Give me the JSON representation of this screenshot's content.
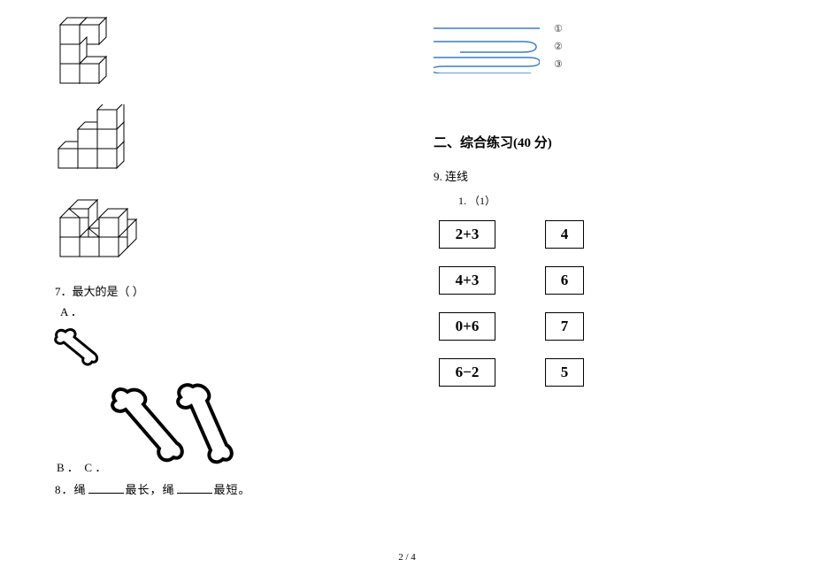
{
  "col_left": {
    "q7": {
      "label": "7．最大的是（  ）",
      "opt_a": "A ．",
      "opt_bc": "B ．  C ．"
    },
    "q8": {
      "prefix": "8．绳",
      "mid": "最长，绳",
      "suffix": "最短。"
    }
  },
  "col_right": {
    "ropes": {
      "n1": "①",
      "n2": "②",
      "n3": "③"
    },
    "section2_heading": "二、综合练习(40 分)",
    "q9_label": "9. 连线",
    "q9_sub": "1. （1）",
    "match_left": [
      "2+3",
      "4+3",
      "0+6",
      "6−2"
    ],
    "match_right": [
      "4",
      "6",
      "7",
      "5"
    ]
  },
  "footer": "2 / 4"
}
